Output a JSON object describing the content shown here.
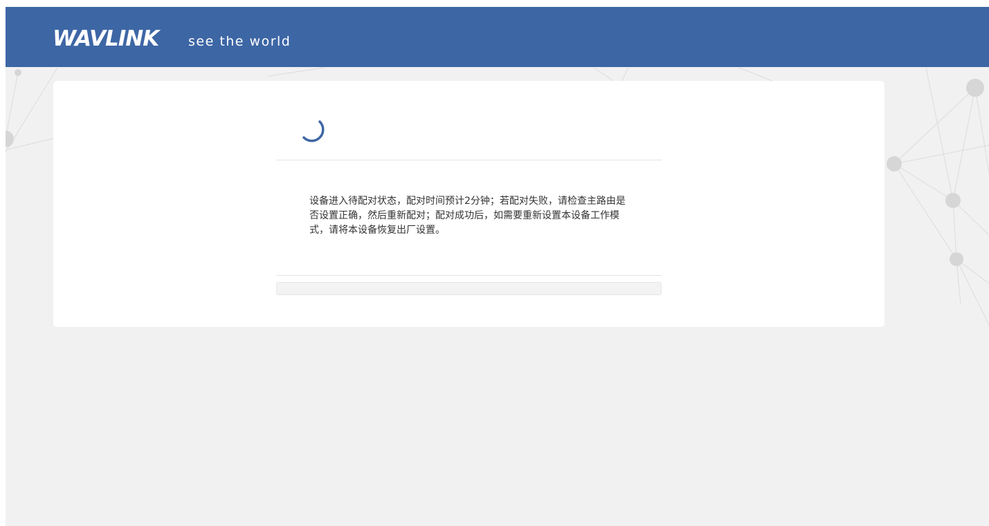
{
  "header": {
    "brand": "WAVLINK",
    "tagline": "see the world",
    "color": "#3d66a5"
  },
  "status": {
    "spinner_icon": "loading-spinner-icon",
    "message": "设备进入待配对状态，配对时间预计2分钟；若配对失败，请检查主路由是否设置正确，然后重新配对；配对成功后，如需要重新设置本设备工作模式，请将本设备恢复出厂设置。",
    "progress_percent": 0
  }
}
